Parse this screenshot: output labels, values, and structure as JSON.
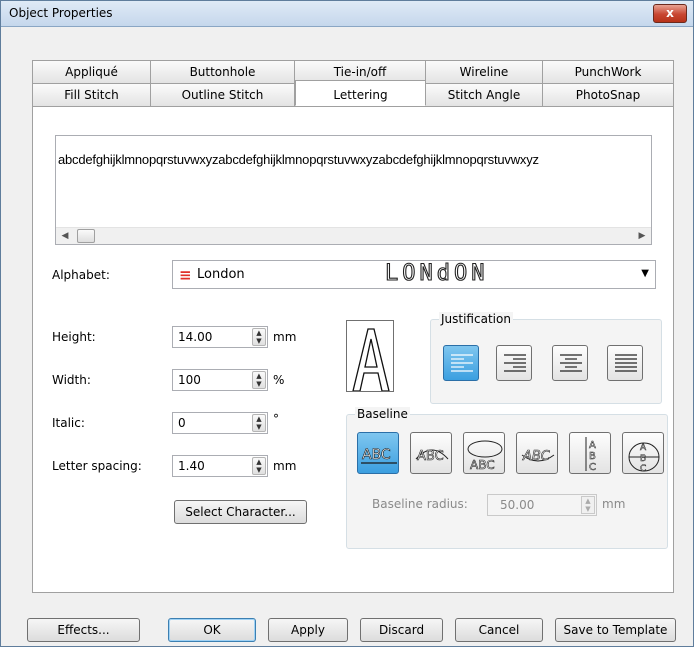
{
  "window": {
    "title": "Object Properties",
    "close_glyph": "x"
  },
  "tabs": {
    "row1": [
      "Appliqué",
      "Buttonhole",
      "Tie-in/off",
      "Wireline",
      "PunchWork"
    ],
    "row2": [
      "Fill Stitch",
      "Outline Stitch",
      "Lettering",
      "Stitch Angle",
      "PhotoSnap"
    ],
    "active": "Lettering"
  },
  "lettering": {
    "text": "abcdefghijklmnopqrstuvwxyzabcdefghijklmnopqrstuvwxyzabcdefghijklmnopqrstuvwxyz",
    "scroll_left": "◀",
    "scroll_right": "▶"
  },
  "alphabet": {
    "label": "Alphabet:",
    "value": "London",
    "preview": "LONdON",
    "icon": "alphabet-stitch-icon",
    "icon_color": "#e0302a"
  },
  "fields": {
    "height": {
      "label": "Height:",
      "value": "14.00",
      "unit": "mm"
    },
    "width": {
      "label": "Width:",
      "value": "100",
      "unit": "%"
    },
    "italic": {
      "label": "Italic:",
      "value": "0",
      "unit": "°"
    },
    "letter_spacing": {
      "label": "Letter spacing:",
      "value": "1.40",
      "unit": "mm"
    }
  },
  "select_character_label": "Select Character...",
  "justification": {
    "title": "Justification",
    "options": [
      "left",
      "right",
      "center",
      "full"
    ],
    "active": "left"
  },
  "baseline": {
    "title": "Baseline",
    "options": [
      "straight",
      "arc-top",
      "circle",
      "arc-bottom",
      "vertical",
      "ellipse"
    ],
    "active": "straight",
    "radius_label": "Baseline radius:",
    "radius_value": "50.00",
    "radius_unit": "mm"
  },
  "buttons": {
    "effects": "Effects...",
    "ok": "OK",
    "apply": "Apply",
    "discard": "Discard",
    "cancel": "Cancel",
    "save_template": "Save to Template"
  },
  "colors": {
    "accent": "#3b9fe0",
    "title_bar": "#c5d7ec"
  }
}
